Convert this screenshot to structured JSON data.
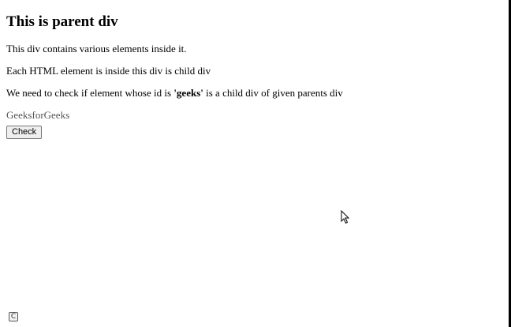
{
  "parent": {
    "heading": "This is parent div",
    "para1": "This div contains various elements inside it.",
    "para2": "Each HTML element is inside this div is child div",
    "para3_before": "We need to check if element whose id is ",
    "para3_bold": "'geeks'",
    "para3_after": " is a child div of given parents div",
    "geeks_text": "GeeksforGeeks",
    "check_button_label": "Check"
  },
  "icons": {
    "cursor": "mouse-pointer-icon",
    "corner": "copyright-badge-icon"
  },
  "colors": {
    "text": "#000000",
    "muted_text": "#555555",
    "button_bg": "#efefef",
    "button_border": "#767676"
  }
}
